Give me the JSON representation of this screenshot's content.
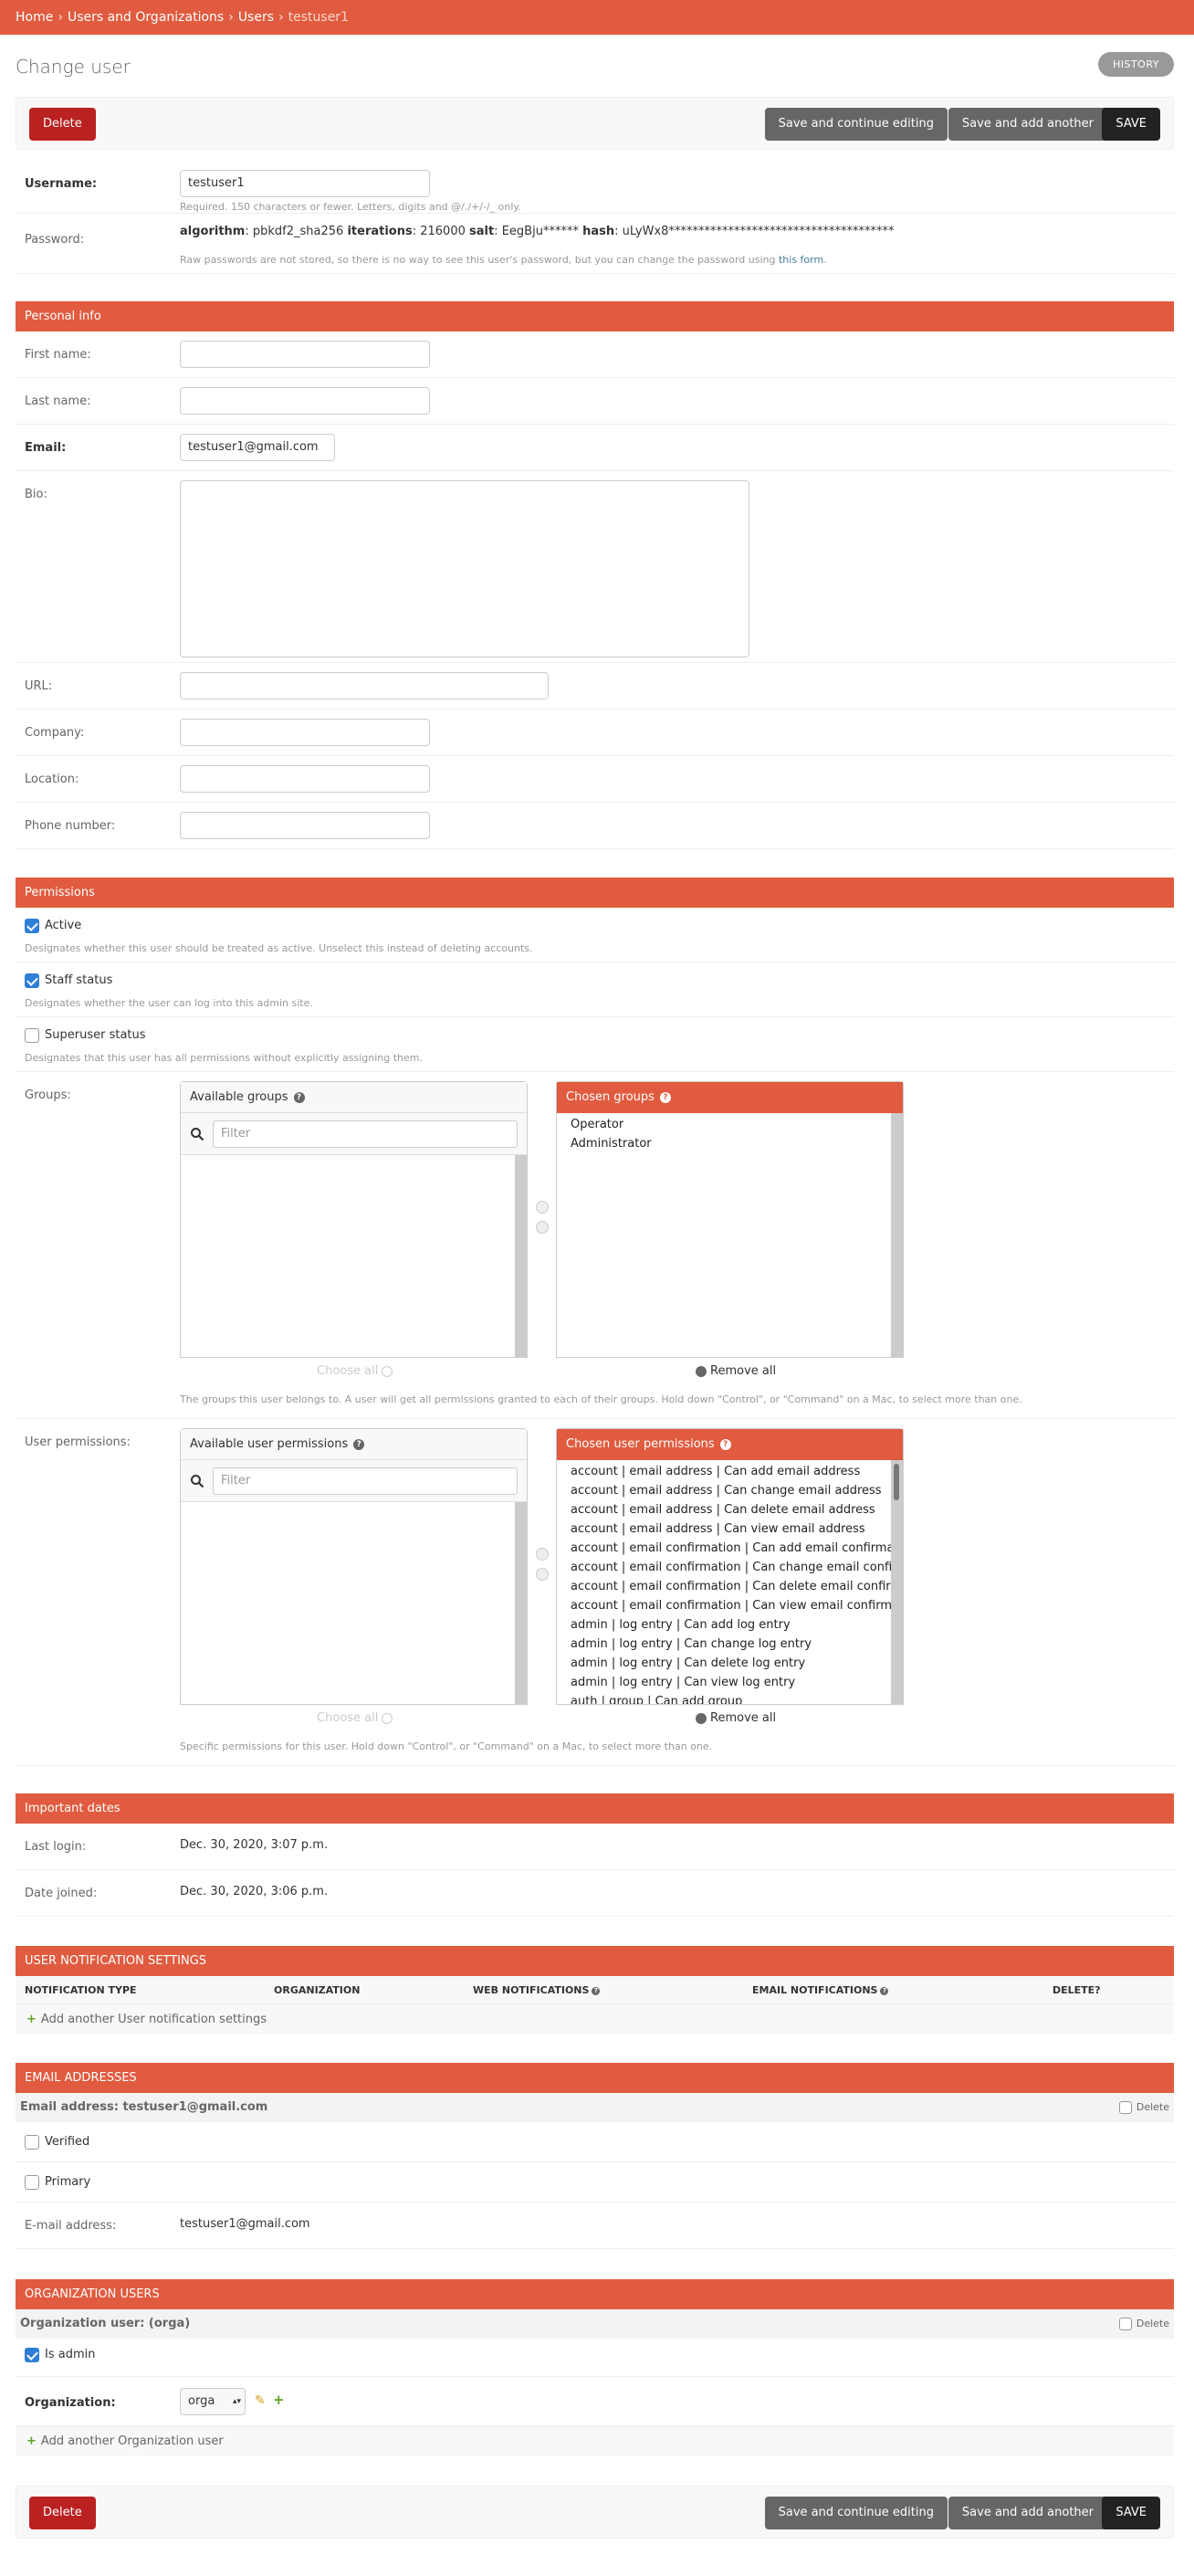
{
  "breadcrumbs": {
    "home": "Home",
    "app": "Users and Organizations",
    "model": "Users",
    "current": "testuser1",
    "sep": "›"
  },
  "page": {
    "title": "Change user",
    "history": "HISTORY"
  },
  "actions": {
    "delete": "Delete",
    "save_continue": "Save and continue editing",
    "save_add": "Save and add another",
    "save": "SAVE"
  },
  "account": {
    "username_label": "Username:",
    "username_value": "testuser1",
    "username_help": "Required. 150 characters or fewer. Letters, digits and @/./+/-/_ only.",
    "password_label": "Password:",
    "pw_algorithm_k": "algorithm",
    "pw_algorithm_v": "pbkdf2_sha256",
    "pw_iterations_k": "iterations",
    "pw_iterations_v": "216000",
    "pw_salt_k": "salt",
    "pw_salt_v": "EegBju******",
    "pw_hash_k": "hash",
    "pw_hash_v": "uLyWx8**************************************",
    "password_help": "Raw passwords are not stored, so there is no way to see this user's password, but you can change the password using",
    "password_link": "this form",
    "password_help_end": "."
  },
  "personal": {
    "heading": "Personal info",
    "first_name_label": "First name:",
    "last_name_label": "Last name:",
    "email_label": "Email:",
    "email_value": "testuser1@gmail.com",
    "bio_label": "Bio:",
    "url_label": "URL:",
    "company_label": "Company:",
    "location_label": "Location:",
    "phone_label": "Phone number:"
  },
  "permissions": {
    "heading": "Permissions",
    "active_label": "Active",
    "active_help": "Designates whether this user should be treated as active. Unselect this instead of deleting accounts.",
    "staff_label": "Staff status",
    "staff_help": "Designates whether the user can log into this admin site.",
    "superuser_label": "Superuser status",
    "superuser_help": "Designates that this user has all permissions without explicitly assigning them.",
    "groups_label": "Groups:",
    "available_groups": "Available groups",
    "chosen_groups": "Chosen groups",
    "filter_placeholder": "Filter",
    "chosen_group_items": [
      "Operator",
      "Administrator"
    ],
    "choose_all": "Choose all",
    "remove_all": "Remove all",
    "groups_help": "The groups this user belongs to. A user will get all permissions granted to each of their groups. Hold down \"Control\", or \"Command\" on a Mac, to select more than one.",
    "user_perms_label": "User permissions:",
    "available_perms": "Available user permissions",
    "chosen_perms": "Chosen user permissions",
    "chosen_perm_items": [
      "account | email address | Can add email address",
      "account | email address | Can change email address",
      "account | email address | Can delete email address",
      "account | email address | Can view email address",
      "account | email confirmation | Can add email confirmation",
      "account | email confirmation | Can change email confirmation",
      "account | email confirmation | Can delete email confirmation",
      "account | email confirmation | Can view email confirmation",
      "admin | log entry | Can add log entry",
      "admin | log entry | Can change log entry",
      "admin | log entry | Can delete log entry",
      "admin | log entry | Can view log entry",
      "auth | group | Can add group"
    ],
    "perms_help": "Specific permissions for this user. Hold down \"Control\", or \"Command\" on a Mac, to select more than one."
  },
  "dates": {
    "heading": "Important dates",
    "last_login_label": "Last login:",
    "last_login_value": "Dec. 30, 2020, 3:07 p.m.",
    "date_joined_label": "Date joined:",
    "date_joined_value": "Dec. 30, 2020, 3:06 p.m."
  },
  "notifications": {
    "heading": "User notification settings",
    "col_type": "NOTIFICATION TYPE",
    "col_org": "ORGANIZATION",
    "col_web": "WEB NOTIFICATIONS",
    "col_email": "EMAIL NOTIFICATIONS",
    "col_delete": "DELETE?",
    "add_another": "Add another User notification settings"
  },
  "emails": {
    "heading": "Email addresses",
    "row_title": "Email address: testuser1@gmail.com",
    "delete_label": "Delete",
    "verified_label": "Verified",
    "primary_label": "Primary",
    "email_label": "E-mail address:",
    "email_value": "testuser1@gmail.com"
  },
  "orgusers": {
    "heading": "Organization users",
    "row_title": "Organization user: (orga)",
    "delete_label": "Delete",
    "is_admin_label": "Is admin",
    "org_label": "Organization:",
    "org_value": "orga",
    "add_another": "Add another Organization user"
  },
  "colors": {
    "accent": "#e05b3f",
    "delete": "#ba2121",
    "button": "#666666",
    "save": "#222222",
    "checkbox": "#2f7ed8",
    "add": "#5fa225"
  }
}
